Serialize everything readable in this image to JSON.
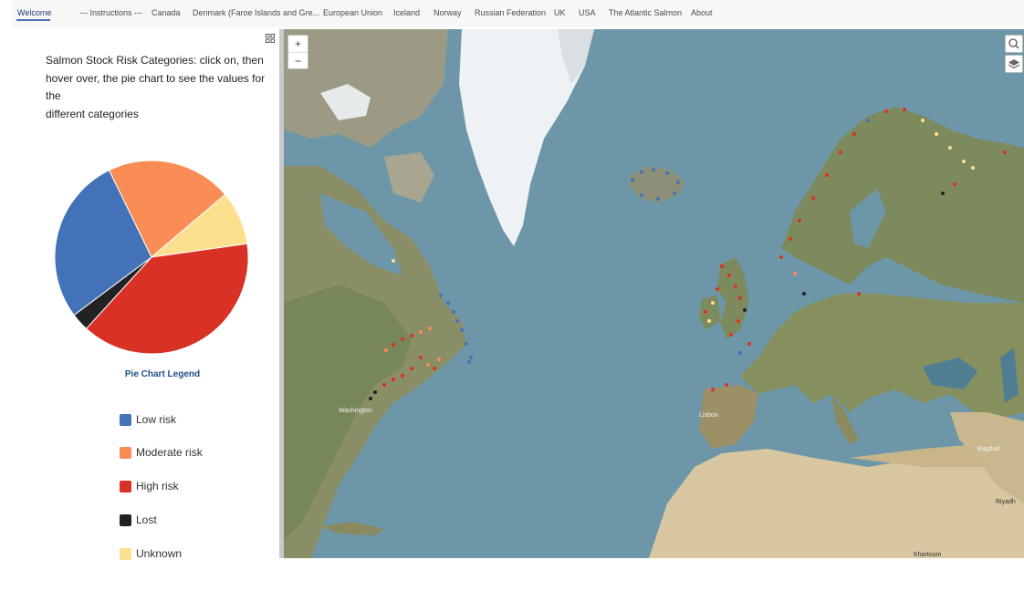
{
  "nav": {
    "items": [
      {
        "label": "Welcome",
        "active": true
      },
      {
        "label": "--- Instructions ---",
        "active": false
      },
      {
        "label": "Canada",
        "active": false
      },
      {
        "label": "Denmark (Faroe Islands and Gre...",
        "active": false
      },
      {
        "label": "European Union",
        "active": false
      },
      {
        "label": "Iceland",
        "active": false
      },
      {
        "label": "Norway",
        "active": false
      },
      {
        "label": "Russian Federation",
        "active": false
      },
      {
        "label": "UK",
        "active": false
      },
      {
        "label": "USA",
        "active": false
      },
      {
        "label": "The Atlantic Salmon",
        "active": false
      },
      {
        "label": "About",
        "active": false
      }
    ]
  },
  "panel": {
    "intro_line1": "Salmon Stock Risk Categories: click on, then",
    "intro_line2": "hover over, the pie chart to see the values for the",
    "intro_line3": "different categories"
  },
  "chart_data": {
    "type": "pie",
    "title": "Pie Chart Legend",
    "categories": [
      "Low risk",
      "Moderate risk",
      "High risk",
      "Lost",
      "Unknown"
    ],
    "values": [
      28,
      21,
      39,
      3,
      9
    ],
    "colors": [
      "#4472b8",
      "#f98d55",
      "#d93126",
      "#222222",
      "#fde08e"
    ]
  },
  "legend": {
    "title": "Pie Chart Legend",
    "items": [
      {
        "label": "Low risk",
        "color": "#4472b8"
      },
      {
        "label": "Moderate risk",
        "color": "#f98d55"
      },
      {
        "label": "High risk",
        "color": "#d93126"
      },
      {
        "label": "Lost",
        "color": "#222222"
      },
      {
        "label": "Unknown",
        "color": "#fde08e"
      }
    ]
  },
  "map": {
    "labels": [
      "Bagdad",
      "Riyadh",
      "Khartoum",
      "Lisbon",
      "Washington"
    ],
    "zoom_in": "+",
    "zoom_out": "−",
    "icons": {
      "search": "search-icon",
      "layers": "layers-icon",
      "expand": "expand-icon"
    }
  }
}
